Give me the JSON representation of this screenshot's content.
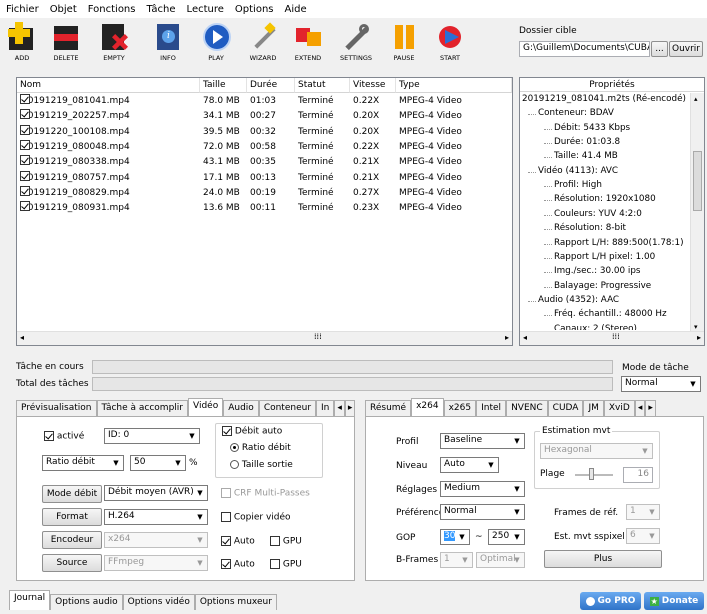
{
  "menu": [
    "Fichier",
    "Objet",
    "Fonctions",
    "Tâche",
    "Lecture",
    "Options",
    "Aide"
  ],
  "toolbar": {
    "add": "ADD",
    "delete": "DELETE",
    "empty": "EMPTY",
    "info": "INFO",
    "play": "PLAY",
    "wizard": "WIZARD",
    "extend": "EXTEND",
    "settings": "SETTINGS",
    "pause": "PAUSE",
    "start": "START"
  },
  "dossier": {
    "label": "Dossier cible",
    "path": "G:\\Guillem\\Documents\\CUBA",
    "browse": "...",
    "open": "Ouvrir"
  },
  "filelist": {
    "headers": [
      "Nom",
      "Taille",
      "Durée",
      "Statut",
      "Vitesse",
      "Type"
    ],
    "rows": [
      [
        "20191219_081041.mp4",
        "78.0 MB",
        "01:03",
        "Terminé",
        "0.22X",
        "MPEG-4 Video"
      ],
      [
        "20191219_202257.mp4",
        "34.1 MB",
        "00:27",
        "Terminé",
        "0.20X",
        "MPEG-4 Video"
      ],
      [
        "20191220_100108.mp4",
        "39.5 MB",
        "00:32",
        "Terminé",
        "0.20X",
        "MPEG-4 Video"
      ],
      [
        "20191219_080048.mp4",
        "72.0 MB",
        "00:58",
        "Terminé",
        "0.22X",
        "MPEG-4 Video"
      ],
      [
        "20191219_080338.mp4",
        "43.1 MB",
        "00:35",
        "Terminé",
        "0.21X",
        "MPEG-4 Video"
      ],
      [
        "20191219_080757.mp4",
        "17.1 MB",
        "00:13",
        "Terminé",
        "0.21X",
        "MPEG-4 Video"
      ],
      [
        "20191219_080829.mp4",
        "24.0 MB",
        "00:19",
        "Terminé",
        "0.27X",
        "MPEG-4 Video"
      ],
      [
        "20191219_080931.mp4",
        "13.6 MB",
        "00:11",
        "Terminé",
        "0.23X",
        "MPEG-4 Video"
      ]
    ]
  },
  "props": {
    "header": "Propriétés",
    "lines": [
      "20191219_081041.m2ts (Ré-encodé)",
      "Conteneur: BDAV",
      "Débit: 5433 Kbps",
      "Durée: 01:03.8",
      "Taille: 41.4 MB",
      "Vidéo (4113): AVC",
      "Profil: High",
      "Résolution: 1920x1080",
      "Couleurs: YUV 4:2:0",
      "Résolution: 8-bit",
      "Rapport L/H: 889:500(1.78:1)",
      "Rapport L/H pixel: 1.00",
      "Img./sec.: 30.00 ips",
      "Balayage: Progressive",
      "Audio (4352): AAC",
      "Fréq. échantill.: 48000 Hz",
      "Canaux: 2 (Stereo)"
    ]
  },
  "progress": {
    "current": "Tâche en cours",
    "total": "Total des tâches",
    "mode_label": "Mode de tâche",
    "mode_value": "Normal"
  },
  "left_tabs": [
    "Prévisualisation",
    "Tâche à accomplir",
    "Vidéo",
    "Audio",
    "Conteneur",
    "In"
  ],
  "video": {
    "active": "activé",
    "id": "ID: 0",
    "ratio": "Ratio débit",
    "ratio_val": "50",
    "pct": "%",
    "debit_auto": "Débit auto",
    "ratio_debit": "Ratio débit",
    "taille_sortie": "Taille sortie",
    "mode_debit": "Mode débit",
    "mode_debit_val": "Débit moyen (AVR)",
    "crf": "CRF Multi-Passes",
    "format": "Format",
    "format_val": "H.264",
    "copier": "Copier vidéo",
    "encodeur": "Encodeur",
    "encodeur_val": "x264",
    "auto": "Auto",
    "gpu": "GPU",
    "source": "Source",
    "source_val": "FFmpeg"
  },
  "right_tabs": [
    "Résumé",
    "x264",
    "x265",
    "Intel",
    "NVENC",
    "CUDA",
    "JM",
    "XviD"
  ],
  "x264": {
    "profil": "Profil",
    "profil_val": "Baseline",
    "niveau": "Niveau",
    "niveau_val": "Auto",
    "reglages": "Réglages",
    "reglages_val": "Medium",
    "preference": "Préférence",
    "preference_val": "Normal",
    "gop": "GOP",
    "gop_min": "30",
    "tilde": "~",
    "gop_max": "250",
    "bframes": "B-Frames",
    "bframes_val": "1",
    "bframes_mode": "Optimal",
    "estim": "Estimation mvt",
    "estim_val": "Hexagonal",
    "plage": "Plage",
    "plage_val": "16",
    "frames_ref": "Frames de réf.",
    "frames_ref_val": "1",
    "est_sspixel": "Est. mvt sspixel",
    "est_sspixel_val": "6",
    "plus": "Plus"
  },
  "bottom_tabs": [
    "Journal",
    "Options audio",
    "Options vidéo",
    "Options muxeur"
  ],
  "gopro": "Go PRO",
  "donate": "Donate"
}
